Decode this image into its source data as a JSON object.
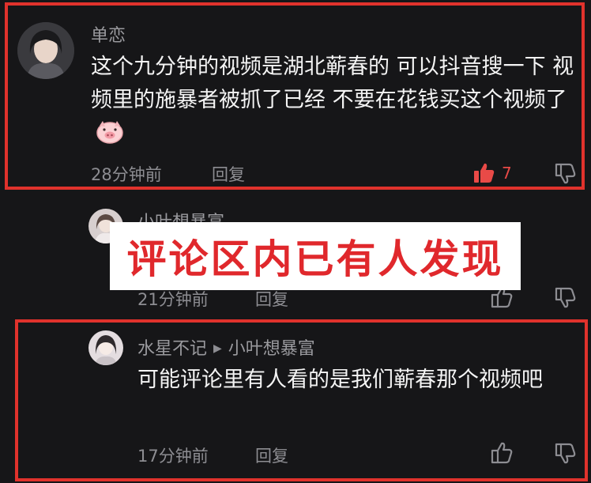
{
  "comments": [
    {
      "username": "单恋",
      "content": "这个九分钟的视频是湖北蕲春的 可以抖音搜一下 视频里的施暴者被抓了已经 不要在花钱买这个视频了",
      "time": "28分钟前",
      "reply_label": "回复",
      "like_count": "7",
      "emoji": "pig-face"
    },
    {
      "username": "小叶想暴富",
      "time": "21分钟前",
      "reply_label": "回复"
    },
    {
      "username": "水星不记",
      "reply_to": "小叶想暴富",
      "content": "可能评论里有人看的是我们蕲春那个视频吧",
      "time": "17分钟前",
      "reply_label": "回复"
    }
  ],
  "overlay_caption": "评论区内已有人发现",
  "colors": {
    "background": "#161618",
    "highlight_frame": "#e0322c",
    "like_active": "#e94a47",
    "caption_text": "#e0282c"
  }
}
